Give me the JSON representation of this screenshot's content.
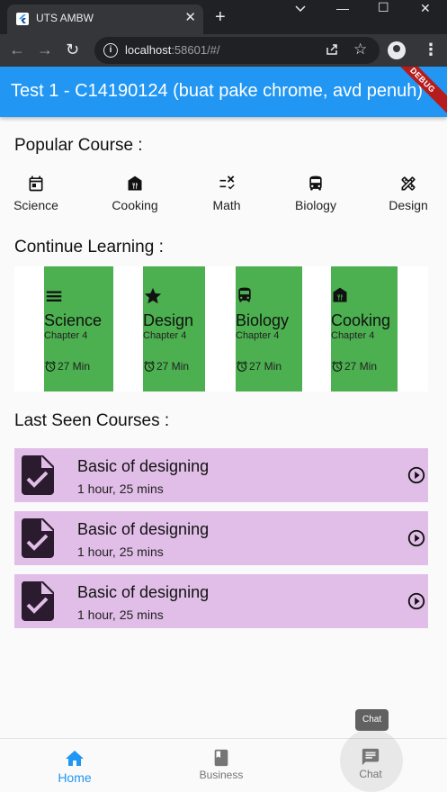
{
  "browser": {
    "tab_title": "UTS AMBW",
    "tab_close": "✕",
    "new_tab": "+",
    "url_host": "localhost",
    "url_rest": ":58601/#/",
    "minimize": "—",
    "maximize": "☐",
    "close": "✕",
    "back": "←",
    "forward": "→",
    "reload": "↻",
    "menu": "⋮"
  },
  "app_bar": {
    "title": "Test 1 - C14190124 (buat pake chrome, avd penuh)",
    "debug_banner": "DEBUG",
    "color": "#2196f3"
  },
  "popular": {
    "heading": "Popular Course :",
    "items": [
      {
        "label": "Science",
        "icon": "calendar-icon"
      },
      {
        "label": "Cooking",
        "icon": "storefront-icon"
      },
      {
        "label": "Math",
        "icon": "math-icon"
      },
      {
        "label": "Biology",
        "icon": "bus-icon"
      },
      {
        "label": "Design",
        "icon": "design-tools-icon"
      }
    ]
  },
  "continue": {
    "heading": "Continue Learning :",
    "card_color": "#4caf50",
    "cards": [
      {
        "title": "Science",
        "chapter": "Chapter 4",
        "time": "27 Min",
        "icon": "list-icon"
      },
      {
        "title": "Design",
        "chapter": "Chapter 4",
        "time": "27 Min",
        "icon": "star-icon"
      },
      {
        "title": "Biology",
        "chapter": "Chapter 4",
        "time": "27 Min",
        "icon": "bus-icon"
      },
      {
        "title": "Cooking",
        "chapter": "Chapter 4",
        "time": "27 Min",
        "icon": "storefront-icon"
      }
    ]
  },
  "last_seen": {
    "heading": "Last Seen Courses :",
    "card_color": "#e1bee7",
    "items": [
      {
        "title": "Basic of designing",
        "duration": "1 hour, 25 mins"
      },
      {
        "title": "Basic of designing",
        "duration": "1 hour, 25 mins"
      },
      {
        "title": "Basic of designing",
        "duration": "1 hour, 25 mins"
      }
    ]
  },
  "bottom_nav": {
    "active_color": "#2196f3",
    "inactive_color": "#757575",
    "items": [
      {
        "label": "Home",
        "icon": "home-icon"
      },
      {
        "label": "Business",
        "icon": "book-icon"
      },
      {
        "label": "Chat",
        "icon": "chat-icon"
      }
    ],
    "tooltip": "Chat"
  }
}
